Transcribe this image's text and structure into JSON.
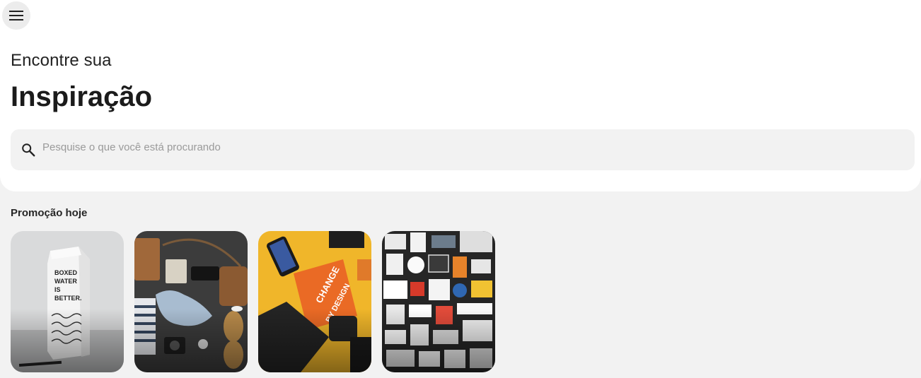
{
  "header": {
    "menu_icon": "menu-icon",
    "subtitle": "Encontre sua",
    "title": "Inspiração"
  },
  "search": {
    "icon": "search-icon",
    "placeholder": "Pesquise o que você está procurando",
    "value": ""
  },
  "promotions": {
    "title": "Promoção hoje",
    "cards": [
      {
        "image": "boxed-water-carton-photo"
      },
      {
        "image": "flat-lay-accessories-photo"
      },
      {
        "image": "change-by-design-book-photo"
      },
      {
        "image": "sticker-wall-photo"
      }
    ]
  },
  "colors": {
    "page_background": "#f2f2f2",
    "panel_background": "#ffffff",
    "search_background": "#f2f2f2"
  }
}
